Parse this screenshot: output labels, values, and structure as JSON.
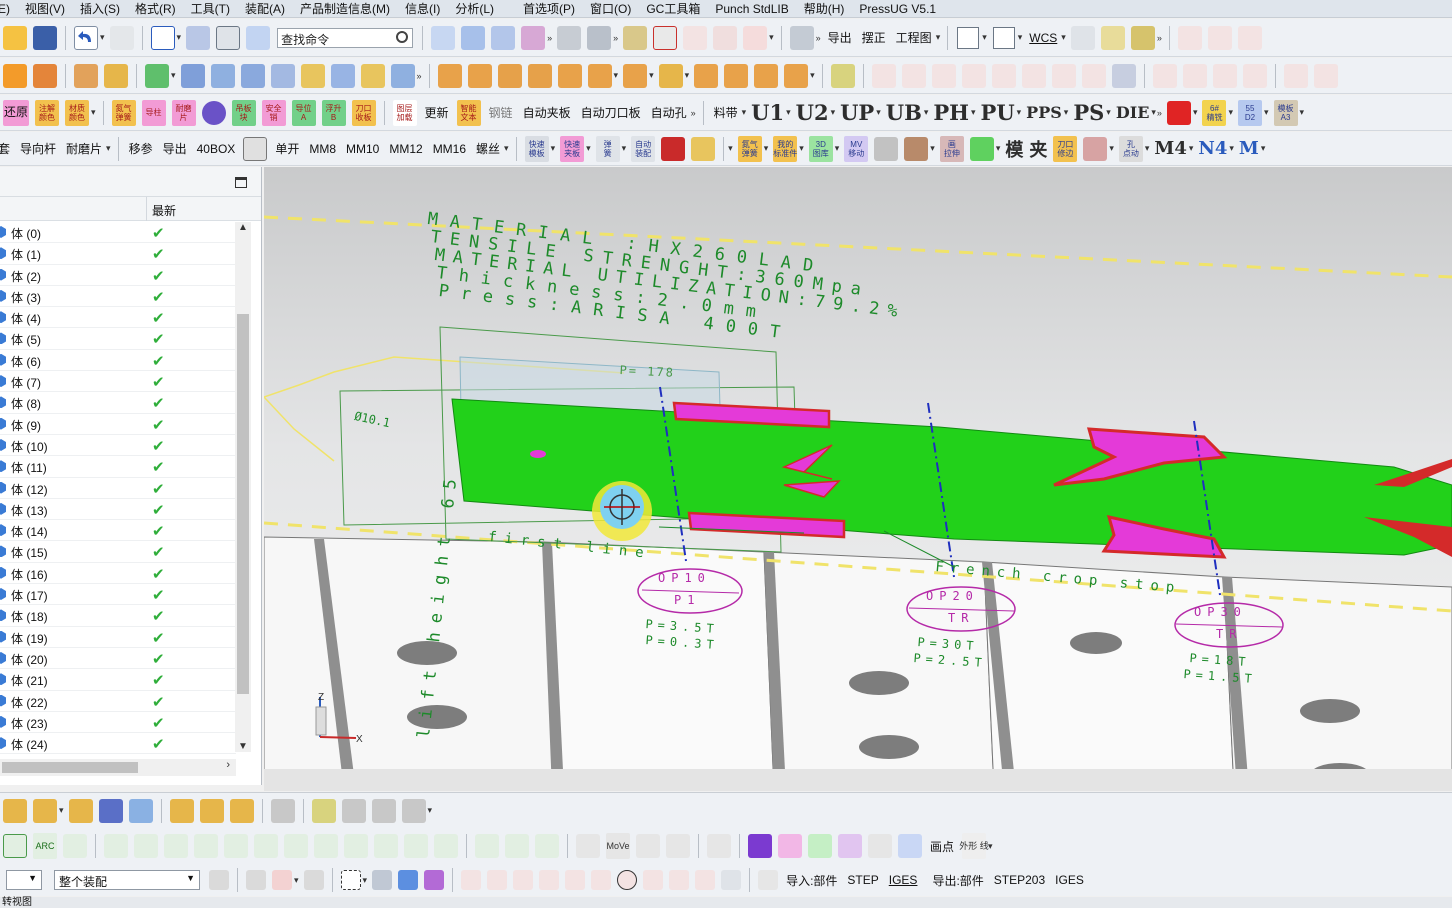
{
  "menu": [
    "E)",
    "视图(V)",
    "插入(S)",
    "格式(R)",
    "工具(T)",
    "装配(A)",
    "产品制造信息(M)",
    "信息(I)",
    "分析(L)",
    "首选项(P)",
    "窗口(O)",
    "GC工具箱",
    "Punch StdLIB",
    "帮助(H)",
    "PressUG V5.1"
  ],
  "toolbar": {
    "search_placeholder": "查找命令",
    "row1_labels": [
      "导出",
      "摆正",
      "工程图"
    ],
    "wcs": "WCS",
    "row3_labels": [
      "还原",
      "更新",
      "钢链",
      "自动夹板",
      "自动刀口板",
      "自动孔",
      "料带"
    ],
    "row3_tiles": [
      {
        "text": "注解\n颜色",
        "color": "#f2c14e"
      },
      {
        "text": "材质\n颜色",
        "color": "#f2c14e"
      },
      {
        "text": "氮气\n弹簧",
        "color": "#f2c14e"
      },
      {
        "text": "导柱",
        "color": "#f29bd5"
      },
      {
        "text": "耐磨\n片",
        "color": "#f29bd5"
      },
      {
        "text": "吊板\n块",
        "color": "#72d089"
      },
      {
        "text": "安全\n销",
        "color": "#f29bd5"
      },
      {
        "text": "导位\nA",
        "color": "#72d089"
      },
      {
        "text": "浮升\nB",
        "color": "#72d089"
      },
      {
        "text": "刀口\n收板",
        "color": "#f2c14e"
      },
      {
        "text": "图层\n加载",
        "color": "#ffffff"
      },
      {
        "text": "智能\n文本",
        "color": "#f2c14e"
      }
    ],
    "big_codes": [
      "U1",
      "U2",
      "UP",
      "UB",
      "PH",
      "PU",
      "PPS",
      "PS",
      "DIE"
    ],
    "row3_right_tiles": [
      "6#\n精铣",
      "55\nD2",
      "模板\nA3"
    ],
    "row4_labels": [
      "套",
      "导向杆",
      "耐磨片",
      "移参",
      "导出",
      "40BOX",
      "单开",
      "MM8",
      "MM10",
      "MM12",
      "MM16",
      "螺丝"
    ],
    "row4_tiles": [
      "快速\n模板",
      "快速\n夹板",
      "弹\n簧",
      "自动\n装配",
      "氮气\n弹簧",
      "我的\n标准件",
      "3D\n图库",
      "MV\n移动",
      "画\n拉伸",
      "模",
      "夹",
      "刀口\n修边",
      "孔\n点动",
      "M4",
      "N4",
      "M"
    ]
  },
  "left_panel": {
    "col_header": "最新",
    "row_prefix": "体",
    "rows": [
      "体 (0)",
      "体 (1)",
      "体 (2)",
      "体 (3)",
      "体 (4)",
      "体 (5)",
      "体 (6)",
      "体 (7)",
      "体 (8)",
      "体 (9)",
      "体 (10)",
      "体 (11)",
      "体 (12)",
      "体 (13)",
      "体 (14)",
      "体 (15)",
      "体 (16)",
      "体 (17)",
      "体 (18)",
      "体 (19)",
      "体 (20)",
      "体 (21)",
      "体 (22)",
      "体 (23)",
      "体 (24)"
    ],
    "status_icon": "checkmark-icon"
  },
  "viewport": {
    "material_lines": [
      "MATERIAL :HX260LAD",
      "TENSILE STRENGHT:360Mpa",
      "MATERIAL UTILIZATION:79.2%",
      "Thickness:2.0mm",
      "Press:ARISA 400T"
    ],
    "p_label": "P= 178",
    "dim_label": "Ø10.1",
    "first_line": "first line",
    "lift_height": "lift height 65",
    "french_crop": "French crop stop",
    "stations": [
      {
        "op": "OP10",
        "name": "P1",
        "p1": "P=3.5T",
        "p2": "P=0.3T"
      },
      {
        "op": "OP20",
        "name": "TR",
        "p1": "P=30T",
        "p2": "P=2.5T"
      },
      {
        "op": "OP30",
        "name": "TR",
        "p1": "P=18T",
        "p2": "P=1.5T"
      }
    ],
    "triad": {
      "z": "Z",
      "x": "X"
    },
    "colors": {
      "strip": "#22d11a",
      "feature": "#e43ad8",
      "outline": "#d42a2a",
      "annotation": "#1d8a2a",
      "center_line": "#1f2fbf"
    }
  },
  "bottom": {
    "arc_label": "ARC",
    "move_label": "MoVe",
    "draw_label": "画点",
    "outline_label": "外形\n线",
    "assembly_select": "整个装配",
    "import_part": "导入:部件",
    "import_formats": [
      "STEP",
      "IGES"
    ],
    "export_part": "导出:部件",
    "export_formats": [
      "STEP203",
      "IGES"
    ]
  },
  "status": "转视图"
}
